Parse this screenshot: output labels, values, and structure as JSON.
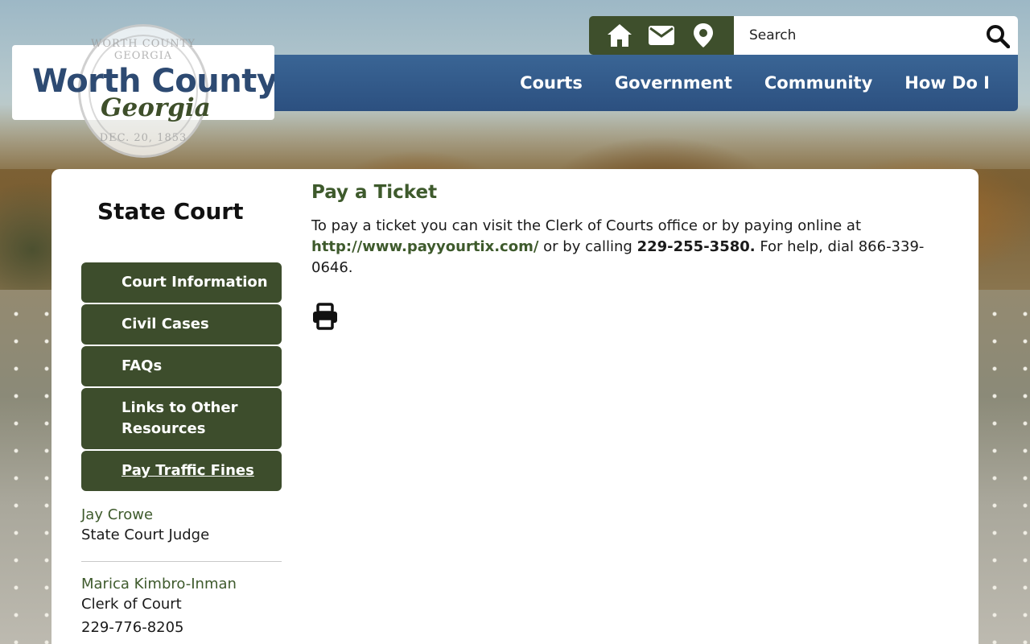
{
  "header": {
    "logo_title": "Worth County",
    "logo_subtitle": "Georgia",
    "seal_top": "WORTH COUNTY GEORGIA",
    "seal_bottom": "DEC. 20, 1853",
    "search_placeholder": "Search",
    "util_icons": [
      "home-icon",
      "email-icon",
      "location-icon"
    ],
    "nav": [
      "Courts",
      "Government",
      "Community",
      "How Do I"
    ]
  },
  "sidebar": {
    "title": "State Court",
    "links": [
      "Court Information",
      "Civil Cases",
      "FAQs",
      "Links to Other Resources",
      "Pay Traffic Fines"
    ],
    "contacts": [
      {
        "name": "Jay Crowe",
        "role": "State Court Judge"
      },
      {
        "name": "Marica Kimbro-Inman",
        "role": "Clerk of Court",
        "phone": "229-776-8205"
      }
    ]
  },
  "main": {
    "title": "Pay a Ticket",
    "para_1": "To pay a ticket you can visit the Clerk of Courts office or by paying online at ",
    "link": "http://www.payyourtix.com/",
    "para_2": " or by calling ",
    "phone": "229-255-3580.",
    "para_3": " For help, dial 866-339-0646."
  },
  "colors": {
    "brand_green": "#3e4f2c",
    "nav_blue": "#2c5080",
    "title_blue": "#2d4a72"
  }
}
